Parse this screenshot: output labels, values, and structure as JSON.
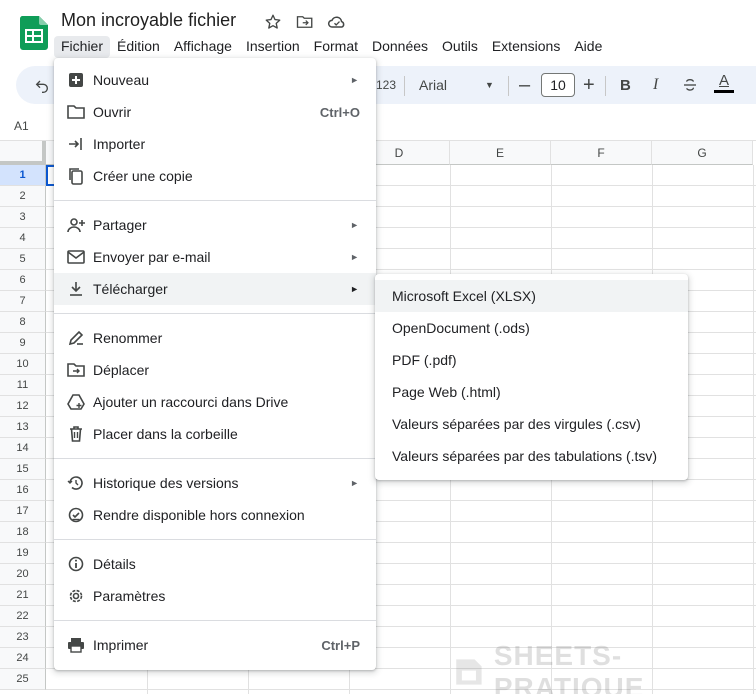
{
  "document": {
    "title": "Mon incroyable fichier"
  },
  "menubar": [
    "Fichier",
    "Édition",
    "Affichage",
    "Insertion",
    "Format",
    "Données",
    "Outils",
    "Extensions",
    "Aide"
  ],
  "toolbar": {
    "format_123": "123",
    "font": "Arial",
    "font_size": "10",
    "bold": "B",
    "italic": "I",
    "text_color": "A"
  },
  "name_box": "A1",
  "columns": [
    "D",
    "E",
    "F",
    "G"
  ],
  "rows": [
    "1",
    "2",
    "3",
    "4",
    "5",
    "6",
    "7",
    "8",
    "9",
    "10",
    "11",
    "12",
    "13",
    "14",
    "15",
    "16",
    "17",
    "18",
    "19",
    "20",
    "21",
    "22",
    "23",
    "24",
    "25"
  ],
  "file_menu": {
    "items": [
      {
        "label": "Nouveau",
        "icon": "new-sheet-icon",
        "submenu": true
      },
      {
        "label": "Ouvrir",
        "icon": "folder-open-icon",
        "shortcut": "Ctrl+O"
      },
      {
        "label": "Importer",
        "icon": "import-icon"
      },
      {
        "label": "Créer une copie",
        "icon": "copy-icon"
      },
      {
        "label": "Partager",
        "icon": "share-person-icon",
        "submenu": true
      },
      {
        "label": "Envoyer par e-mail",
        "icon": "email-icon",
        "submenu": true
      },
      {
        "label": "Télécharger",
        "icon": "download-icon",
        "submenu": true,
        "highlighted": true
      },
      {
        "label": "Renommer",
        "icon": "rename-icon"
      },
      {
        "label": "Déplacer",
        "icon": "move-folder-icon"
      },
      {
        "label": "Ajouter un raccourci dans Drive",
        "icon": "drive-shortcut-icon"
      },
      {
        "label": "Placer dans la corbeille",
        "icon": "trash-icon"
      },
      {
        "label": "Historique des versions",
        "icon": "history-icon",
        "submenu": true
      },
      {
        "label": "Rendre disponible hors connexion",
        "icon": "offline-icon"
      },
      {
        "label": "Détails",
        "icon": "info-icon"
      },
      {
        "label": "Paramètres",
        "icon": "settings-icon"
      },
      {
        "label": "Imprimer",
        "icon": "print-icon",
        "shortcut": "Ctrl+P"
      }
    ]
  },
  "download_submenu": {
    "items": [
      "Microsoft Excel (XLSX)",
      "OpenDocument (.ods)",
      "PDF (.pdf)",
      "Page Web (.html)",
      "Valeurs séparées par des virgules (.csv)",
      "Valeurs séparées par des tabulations (.tsv)"
    ]
  },
  "watermark": "SHEETS-PRATIQUE",
  "colors": {
    "sheets_green": "#0f9d58",
    "toolbar_bg": "#edf2fa",
    "selected_row": "#d3e3fd",
    "hover": "#f1f3f4"
  }
}
